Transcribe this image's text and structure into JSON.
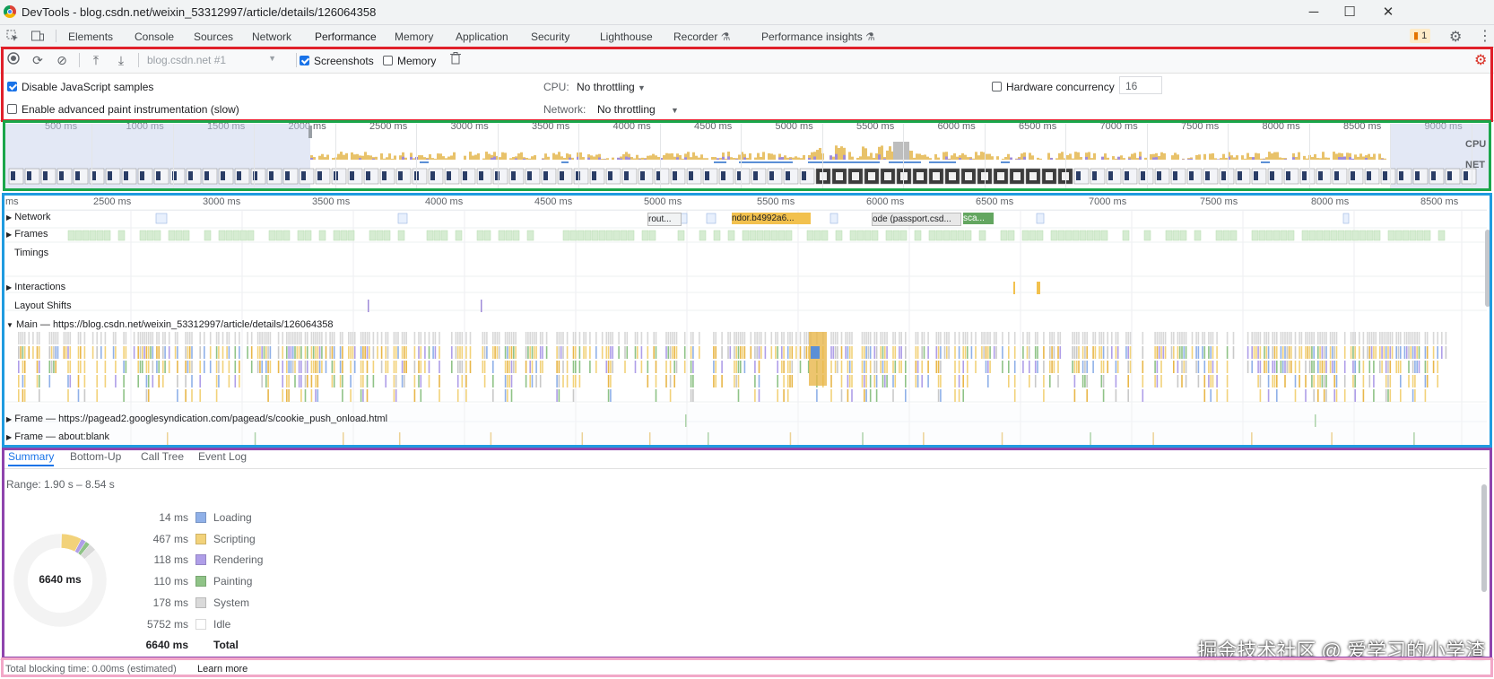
{
  "window": {
    "title": "DevTools - blog.csdn.net/weixin_53312997/article/details/126064358"
  },
  "tabs": [
    {
      "label": "Elements"
    },
    {
      "label": "Console"
    },
    {
      "label": "Sources"
    },
    {
      "label": "Network"
    },
    {
      "label": "Performance"
    },
    {
      "label": "Memory"
    },
    {
      "label": "Application"
    },
    {
      "label": "Security"
    },
    {
      "label": "Lighthouse"
    },
    {
      "label": "Recorder"
    },
    {
      "label": "Performance insights"
    }
  ],
  "issues_badge": "1",
  "toolbar": {
    "profile_select": "blog.csdn.net #1",
    "screenshots_label": "Screenshots",
    "memory_label": "Memory"
  },
  "settings": {
    "disable_js_samples": "Disable JavaScript samples",
    "advanced_paint": "Enable advanced paint instrumentation (slow)",
    "cpu_label": "CPU:",
    "cpu_value": "No throttling",
    "network_label": "Network:",
    "network_value": "No throttling",
    "hw_concurrency_label": "Hardware concurrency",
    "hw_concurrency_value": "16"
  },
  "overview": {
    "ticks": [
      "500 ms",
      "1000 ms",
      "1500 ms",
      "2000 ms",
      "2500 ms",
      "3000 ms",
      "3500 ms",
      "4000 ms",
      "4500 ms",
      "5000 ms",
      "5500 ms",
      "6000 ms",
      "6500 ms",
      "7000 ms",
      "7500 ms",
      "8000 ms",
      "8500 ms",
      "9000 ms"
    ],
    "cpu_label": "CPU",
    "net_label": "NET"
  },
  "timeline": {
    "ticks": [
      "ms",
      "2500 ms",
      "3000 ms",
      "3500 ms",
      "4000 ms",
      "4500 ms",
      "5000 ms",
      "5500 ms",
      "6000 ms",
      "6500 ms",
      "7000 ms",
      "7500 ms",
      "8000 ms",
      "8500 ms"
    ],
    "tracks": {
      "network": "Network",
      "frames": "Frames",
      "timings": "Timings",
      "interactions": "Interactions",
      "layout_shifts": "Layout Shifts",
      "main": "Main — https://blog.csdn.net/weixin_53312997/article/details/126064358",
      "frame1": "Frame — https://pagead2.googlesyndication.com/pagead/s/cookie_push_onload.html",
      "frame2": "Frame — about:blank"
    },
    "net_labels": [
      "rout...",
      "ndor.b4992a6...",
      "ode (passport.csd...",
      "sca..."
    ]
  },
  "summary": {
    "tabs": [
      "Summary",
      "Bottom-Up",
      "Call Tree",
      "Event Log"
    ],
    "range": "Range: 1.90 s – 8.54 s",
    "total_center": "6640 ms",
    "rows": [
      {
        "ms": "14 ms",
        "name": "Loading",
        "color": "#8fb0e8"
      },
      {
        "ms": "467 ms",
        "name": "Scripting",
        "color": "#f2d27a"
      },
      {
        "ms": "118 ms",
        "name": "Rendering",
        "color": "#af9ee8"
      },
      {
        "ms": "110 ms",
        "name": "Painting",
        "color": "#8fc387"
      },
      {
        "ms": "178 ms",
        "name": "System",
        "color": "#dadada"
      },
      {
        "ms": "5752 ms",
        "name": "Idle",
        "color": "#ffffff"
      }
    ],
    "total": {
      "ms": "6640 ms",
      "name": "Total"
    }
  },
  "status": {
    "text": "Total blocking time: 0.00ms (estimated)",
    "link": "Learn more"
  },
  "watermark": "掘金技术社区 @ 爱学习的小学渣",
  "colors": {
    "highlight_red": "#e0202a",
    "highlight_green": "#1aa64a",
    "highlight_blue": "#1f9be0",
    "highlight_purple": "#8e44ad",
    "highlight_pink": "#f2a8c8"
  }
}
